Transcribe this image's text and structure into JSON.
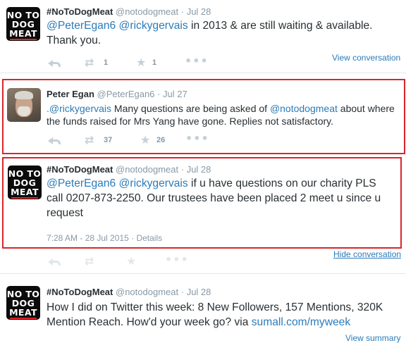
{
  "tweets": [
    {
      "avatar_text": [
        "NO TO",
        "DOG",
        "MEAT"
      ],
      "fullname": "#NoToDogMeat",
      "handle": "@notodogmeat",
      "dot": "·",
      "time": "Jul 28",
      "mention1": "@PeterEgan6",
      "mention2": "@rickygervais",
      "text_rest": " in 2013 & are still waiting & available. Thank you.",
      "retweets": "1",
      "favorites": "1",
      "right_link": "View conversation"
    },
    {
      "fullname": "Peter Egan",
      "handle": "@PeterEgan6",
      "dot": "·",
      "time": "Jul 27",
      "mention1": ".@rickygervais",
      "text_mid": " Many questions are being asked of ",
      "mention2": "@notodogmeat",
      "text_rest": " about where the funds raised for Mrs Yang have gone. Replies not satisfactory.",
      "retweets": "37",
      "favorites": "26"
    },
    {
      "avatar_text": [
        "NO TO",
        "DOG",
        "MEAT"
      ],
      "fullname": "#NoToDogMeat",
      "handle": "@notodogmeat",
      "dot": "·",
      "time": "Jul 28",
      "mention1": "@PeterEgan6",
      "mention2": "@rickygervais",
      "text_rest": " if u have questions on our charity PLS call 0207-873-2250. Our trustees have been placed 2 meet u since u request",
      "timestamp": "7:28 AM - 28 Jul 2015",
      "details_sep": "·",
      "details": "Details",
      "right_link": "Hide conversation"
    },
    {
      "avatar_text": [
        "NO TO",
        "DOG",
        "MEAT"
      ],
      "fullname": "#NoToDogMeat",
      "handle": "@notodogmeat",
      "dot": "·",
      "time": "Jul 28",
      "text_main": "How I did on Twitter this week: 8 New Followers, 157 Mentions, 320K Mention Reach. How'd your week go? via ",
      "link": "sumall.com/myweek",
      "right_link": "View summary"
    }
  ],
  "colors": {
    "link": "#2b7bb9",
    "highlight_box": "#d8262b",
    "muted": "#8899a6"
  },
  "icons": [
    "reply-icon",
    "retweet-icon",
    "favorite-icon",
    "more-icon"
  ]
}
